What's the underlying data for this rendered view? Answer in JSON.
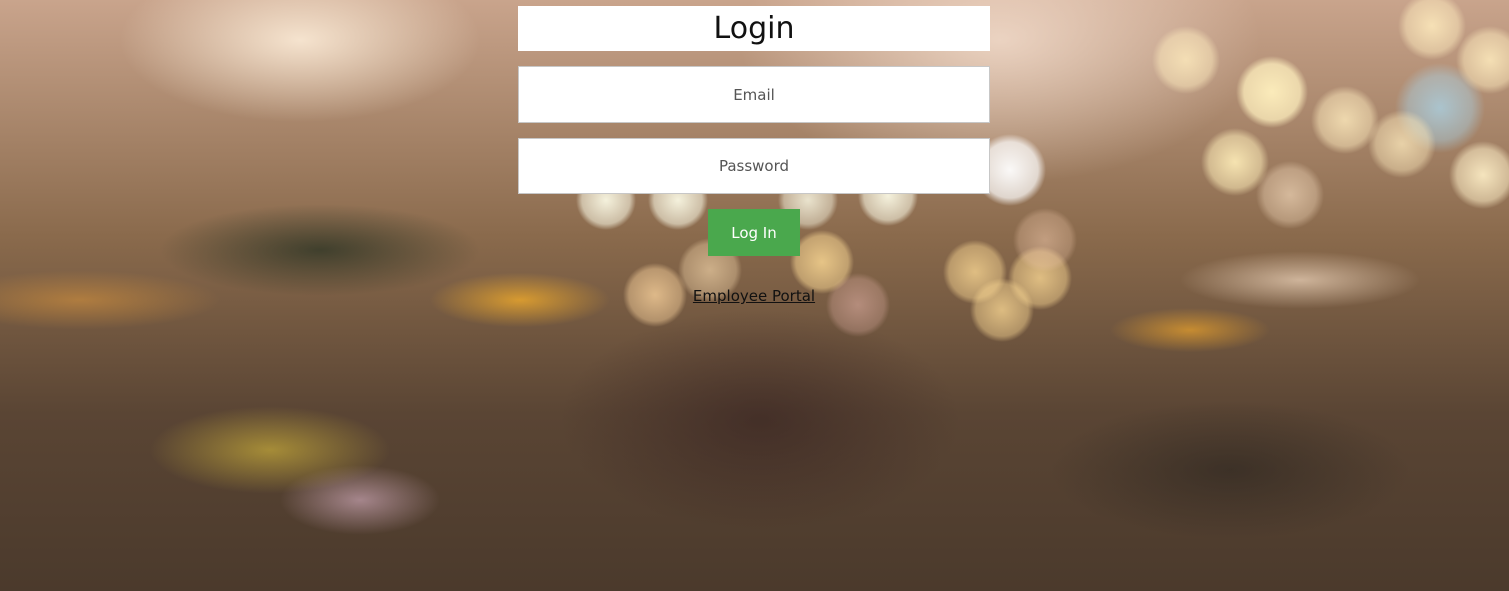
{
  "login": {
    "title": "Login",
    "email_placeholder": "Email",
    "password_placeholder": "Password",
    "submit_label": "Log In",
    "portal_link_label": "Employee Portal"
  },
  "colors": {
    "button_background": "#4aa84d",
    "button_text": "#ffffff",
    "panel_background": "#ffffff"
  }
}
